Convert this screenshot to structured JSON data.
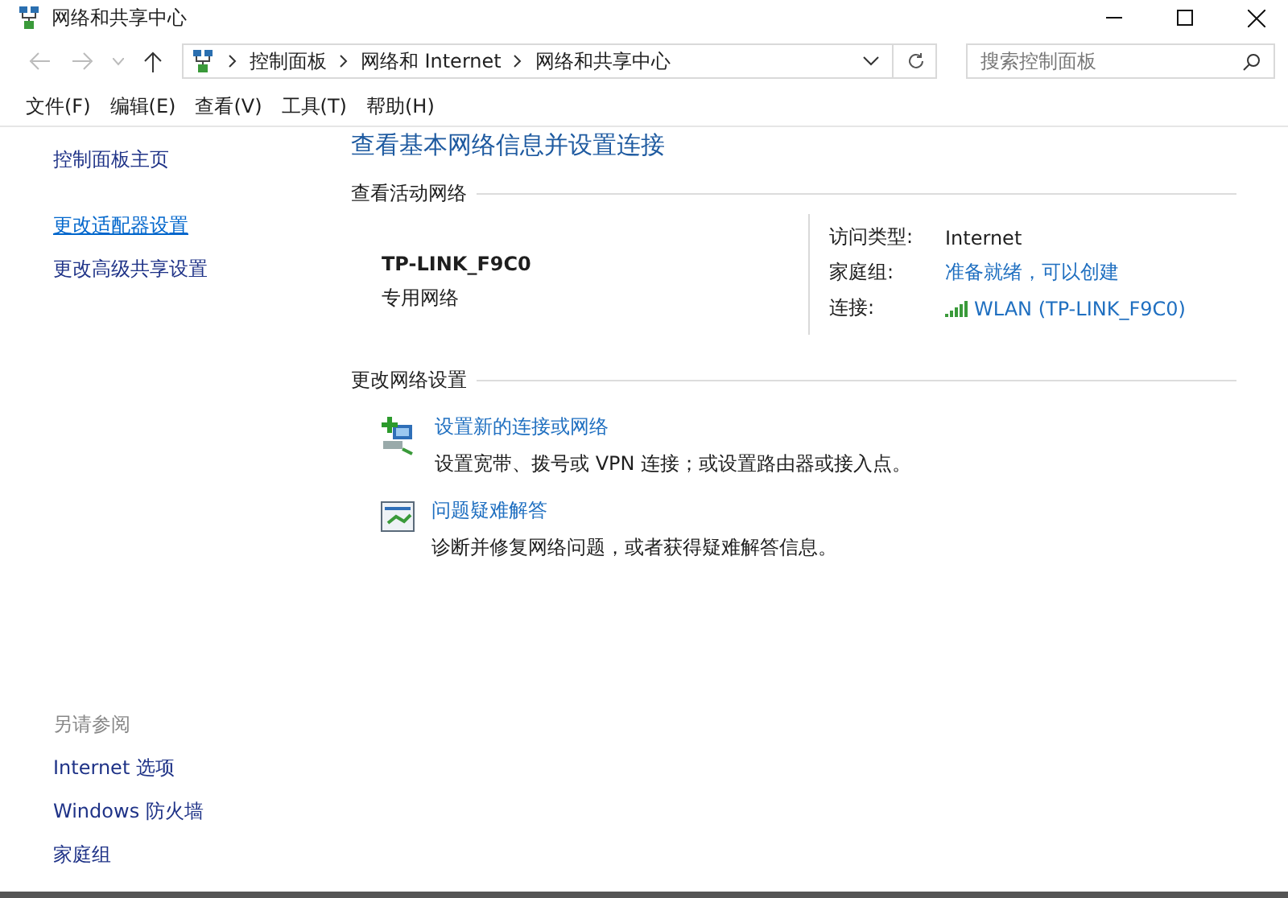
{
  "window": {
    "title": "网络和共享中心"
  },
  "address_bar": {
    "breadcrumbs": [
      "控制面板",
      "网络和 Internet",
      "网络和共享中心"
    ]
  },
  "search": {
    "placeholder": "搜索控制面板"
  },
  "menu": [
    "文件(F)",
    "编辑(E)",
    "查看(V)",
    "工具(T)",
    "帮助(H)"
  ],
  "sidebar": {
    "items": [
      {
        "label": "控制面板主页",
        "hovered": false
      },
      {
        "label": "更改适配器设置",
        "hovered": true
      },
      {
        "label": "更改高级共享设置",
        "hovered": false
      }
    ],
    "see_also": {
      "heading": "另请参阅",
      "items": [
        "Internet 选项",
        "Windows 防火墙",
        "家庭组"
      ]
    }
  },
  "main": {
    "heading": "查看基本网络信息并设置连接",
    "active_network": {
      "section_title": "查看活动网络",
      "name": "TP-LINK_F9C0",
      "category": "专用网络",
      "details": [
        {
          "label": "访问类型:",
          "value": "Internet",
          "kind": "text"
        },
        {
          "label": "家庭组:",
          "value": "准备就绪，可以创建",
          "kind": "link"
        },
        {
          "label": "连接:",
          "value": "WLAN (TP-LINK_F9C0)",
          "kind": "wifi-link"
        }
      ]
    },
    "change_settings": {
      "section_title": "更改网络设置",
      "tasks": [
        {
          "kind": "new-connection",
          "title": "设置新的连接或网络",
          "description": "设置宽带、拨号或 VPN 连接；或设置路由器或接入点。"
        },
        {
          "kind": "troubleshoot",
          "title": "问题疑难解答",
          "description": "诊断并修复网络问题，或者获得疑难解答信息。"
        }
      ]
    }
  }
}
